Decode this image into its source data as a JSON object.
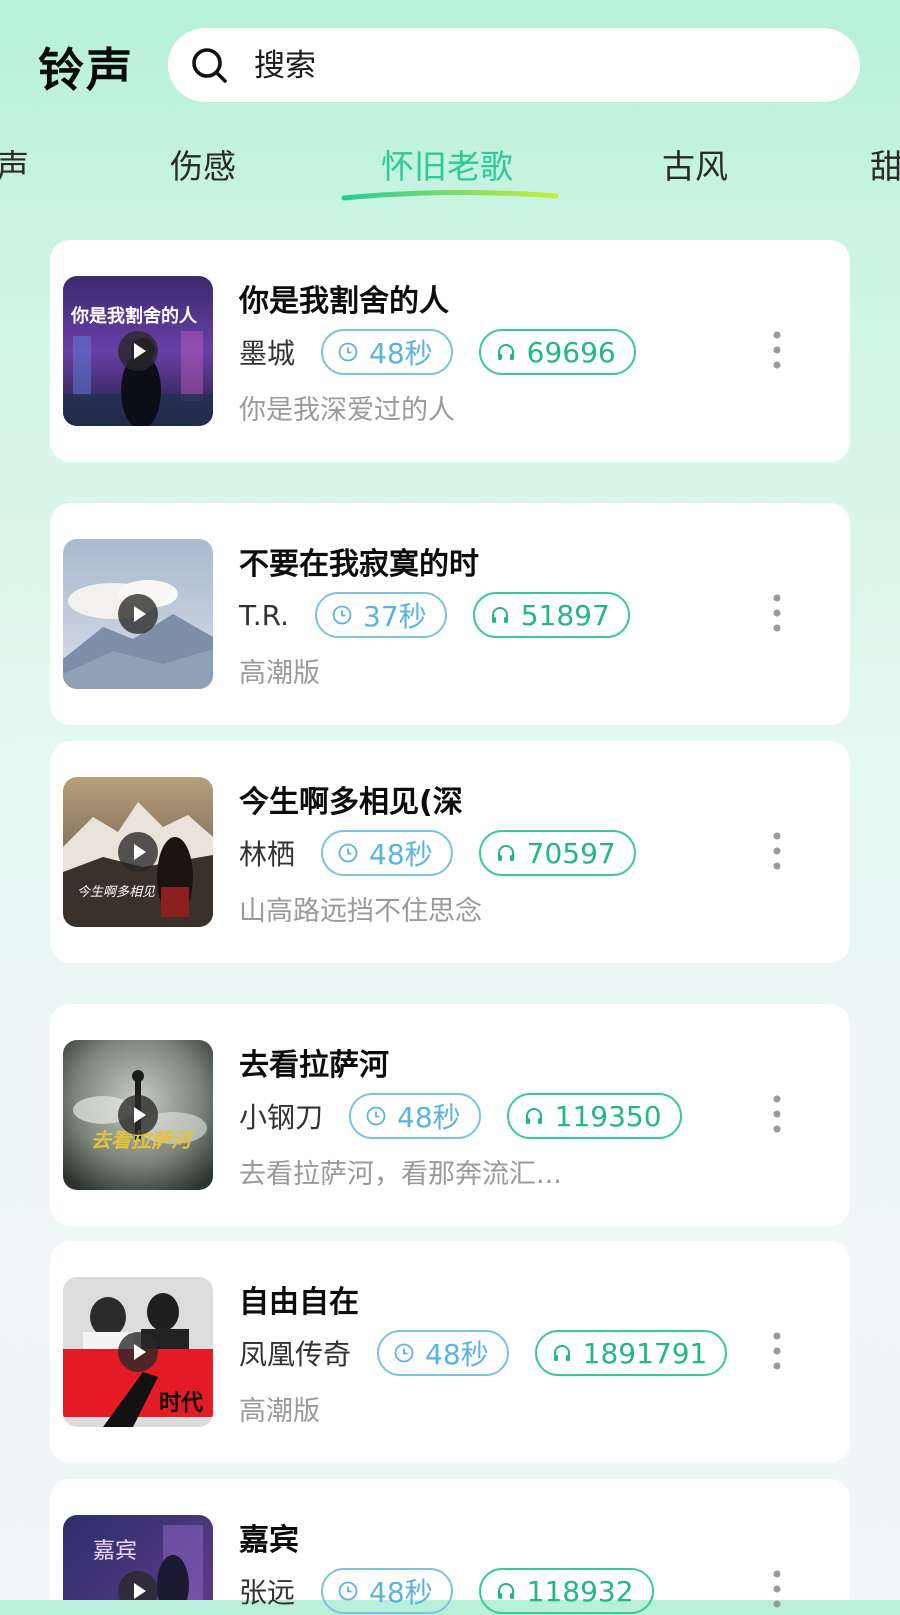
{
  "header": {
    "title": "铃声",
    "search_placeholder": "搜索"
  },
  "tabs": [
    {
      "label": "声",
      "active": false
    },
    {
      "label": "伤感",
      "active": false
    },
    {
      "label": "怀旧老歌",
      "active": true
    },
    {
      "label": "古风",
      "active": false
    },
    {
      "label": "甜",
      "active": false
    }
  ],
  "colors": {
    "accent": "#2dc99a",
    "duration_pill": "#5cb3dc",
    "plays_pill": "#22b884"
  },
  "songs": [
    {
      "title": "你是我割舍的人",
      "artist": "墨城",
      "duration": "48秒",
      "plays": "69696",
      "subtitle": "你是我深爱过的人",
      "cover_text": "你是我割舍的人"
    },
    {
      "title": "不要在我寂寞的时",
      "artist": "T.R.",
      "duration": "37秒",
      "plays": "51897",
      "subtitle": "高潮版",
      "cover_text": ""
    },
    {
      "title": "今生啊多相见(深",
      "artist": "林栖",
      "duration": "48秒",
      "plays": "70597",
      "subtitle": "山高路远挡不住思念",
      "cover_text": "今生啊多相见"
    },
    {
      "title": "去看拉萨河",
      "artist": "小钢刀",
      "duration": "48秒",
      "plays": "119350",
      "subtitle": "去看拉萨河，看那奔流汇...",
      "cover_text": "去看拉萨河"
    },
    {
      "title": "自由自在",
      "artist": "凤凰传奇",
      "duration": "48秒",
      "plays": "1891791",
      "subtitle": "高潮版",
      "cover_text": "时代"
    },
    {
      "title": "嘉宾",
      "artist": "张远",
      "duration": "48秒",
      "plays": "118932",
      "subtitle": "",
      "cover_text": "嘉宾"
    }
  ]
}
